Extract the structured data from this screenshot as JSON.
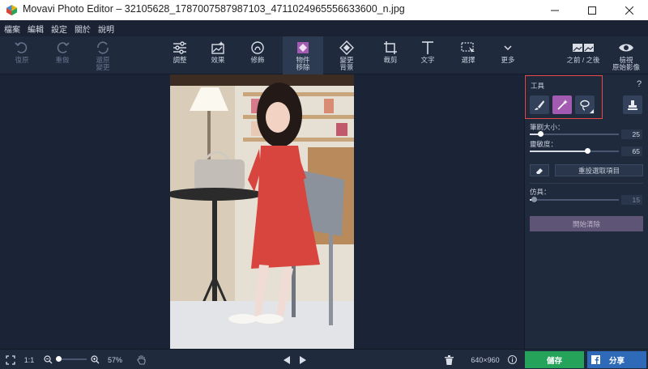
{
  "window": {
    "title": "Movavi Photo Editor – 32105628_1787007587987103_4711024965556633600_n.jpg"
  },
  "menu": [
    "檔案",
    "編輯",
    "設定",
    "關於",
    "說明"
  ],
  "toolbar": {
    "undo": "復原",
    "redo": "重做",
    "restore": "還原\n變更",
    "adjust": "調整",
    "effects": "效果",
    "retouch": "修飾",
    "object_removal": "物件\n移除",
    "change_background": "變更\n背景",
    "crop": "裁剪",
    "text": "文字",
    "select": "選擇",
    "more": "更多",
    "before_after": "之前 / 之後",
    "view_original": "檢視\n原始影像"
  },
  "panel": {
    "tools_label": "工具",
    "help": "?",
    "brush_size_label": "筆刷大小：",
    "brush_size_value": "25",
    "brush_size_fraction": 0.12,
    "sensitivity_label": "靈敏度：",
    "sensitivity_value": "65",
    "sensitivity_fraction": 0.65,
    "reset_selection": "重設選取項目",
    "stamp_label": "仿具：",
    "stamp_value": "15",
    "stamp_fraction": 0.05,
    "start_erase": "開始清除"
  },
  "bottom": {
    "zoom_ratio": "1:1",
    "zoom_percent": "57%",
    "zoom_fraction": 0.1,
    "image_size": "640×960",
    "save": "儲存",
    "share": "分享"
  }
}
